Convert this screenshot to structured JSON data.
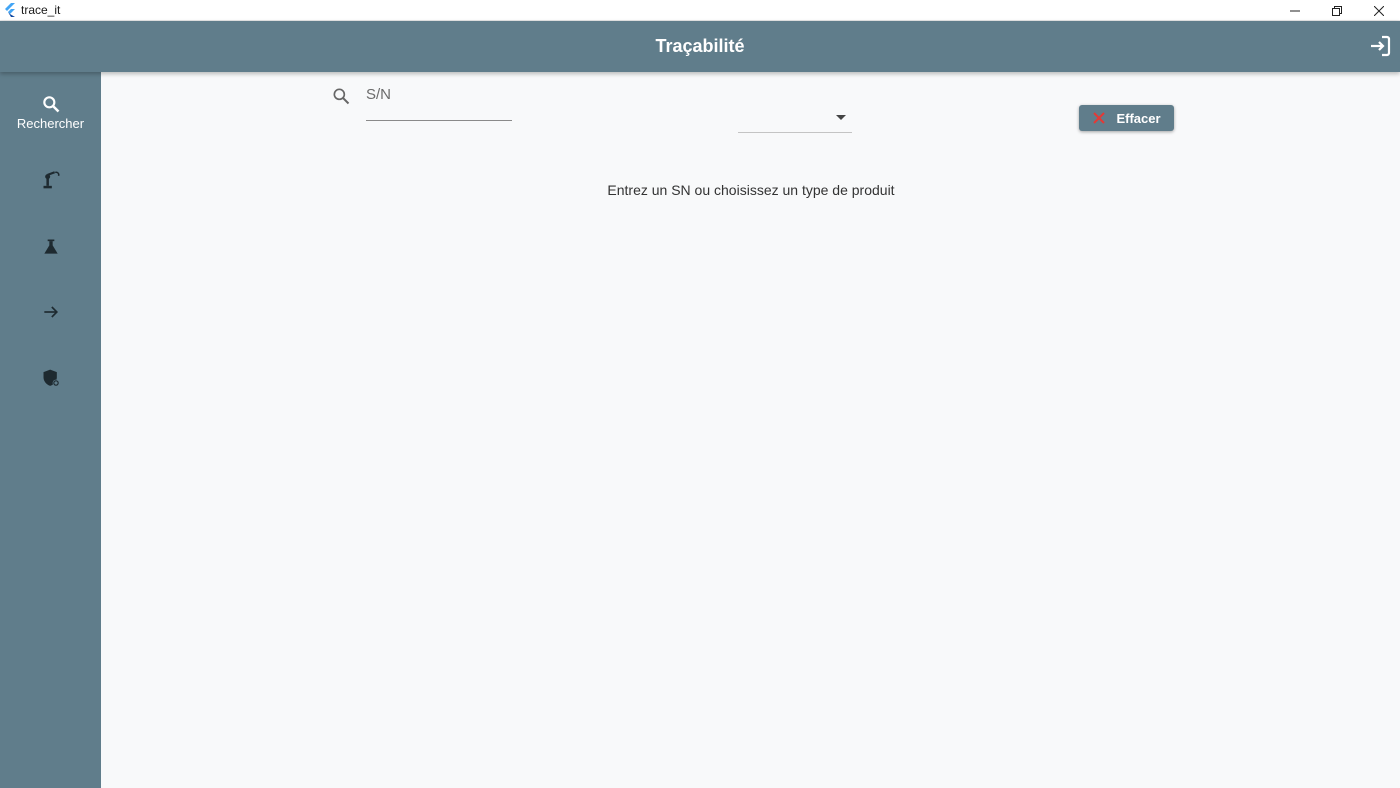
{
  "window": {
    "title": "trace_it",
    "icons": [
      "flutter-logo-icon",
      "minimize-icon",
      "restore-icon",
      "close-icon"
    ]
  },
  "appbar": {
    "title": "Traçabilité",
    "logout_icon": "login-icon"
  },
  "rail": {
    "items": [
      {
        "icon": "search-icon",
        "label": "Rechercher",
        "selected": true
      },
      {
        "icon": "robot-arm-icon",
        "label": ""
      },
      {
        "icon": "flask-icon",
        "label": ""
      },
      {
        "icon": "arrow-right-icon",
        "label": ""
      },
      {
        "icon": "security-settings-icon",
        "label": ""
      }
    ]
  },
  "search": {
    "placeholder": "S/N",
    "value": ""
  },
  "product_type": {
    "selected": ""
  },
  "clear_button": {
    "label": "Effacer",
    "icon": "close-icon"
  },
  "empty_message": "Entrez un SN ou choisissez un type de produit",
  "colors": {
    "primary": "#607d8b",
    "background": "#f8f9fa",
    "clear_icon": "#e53935"
  }
}
